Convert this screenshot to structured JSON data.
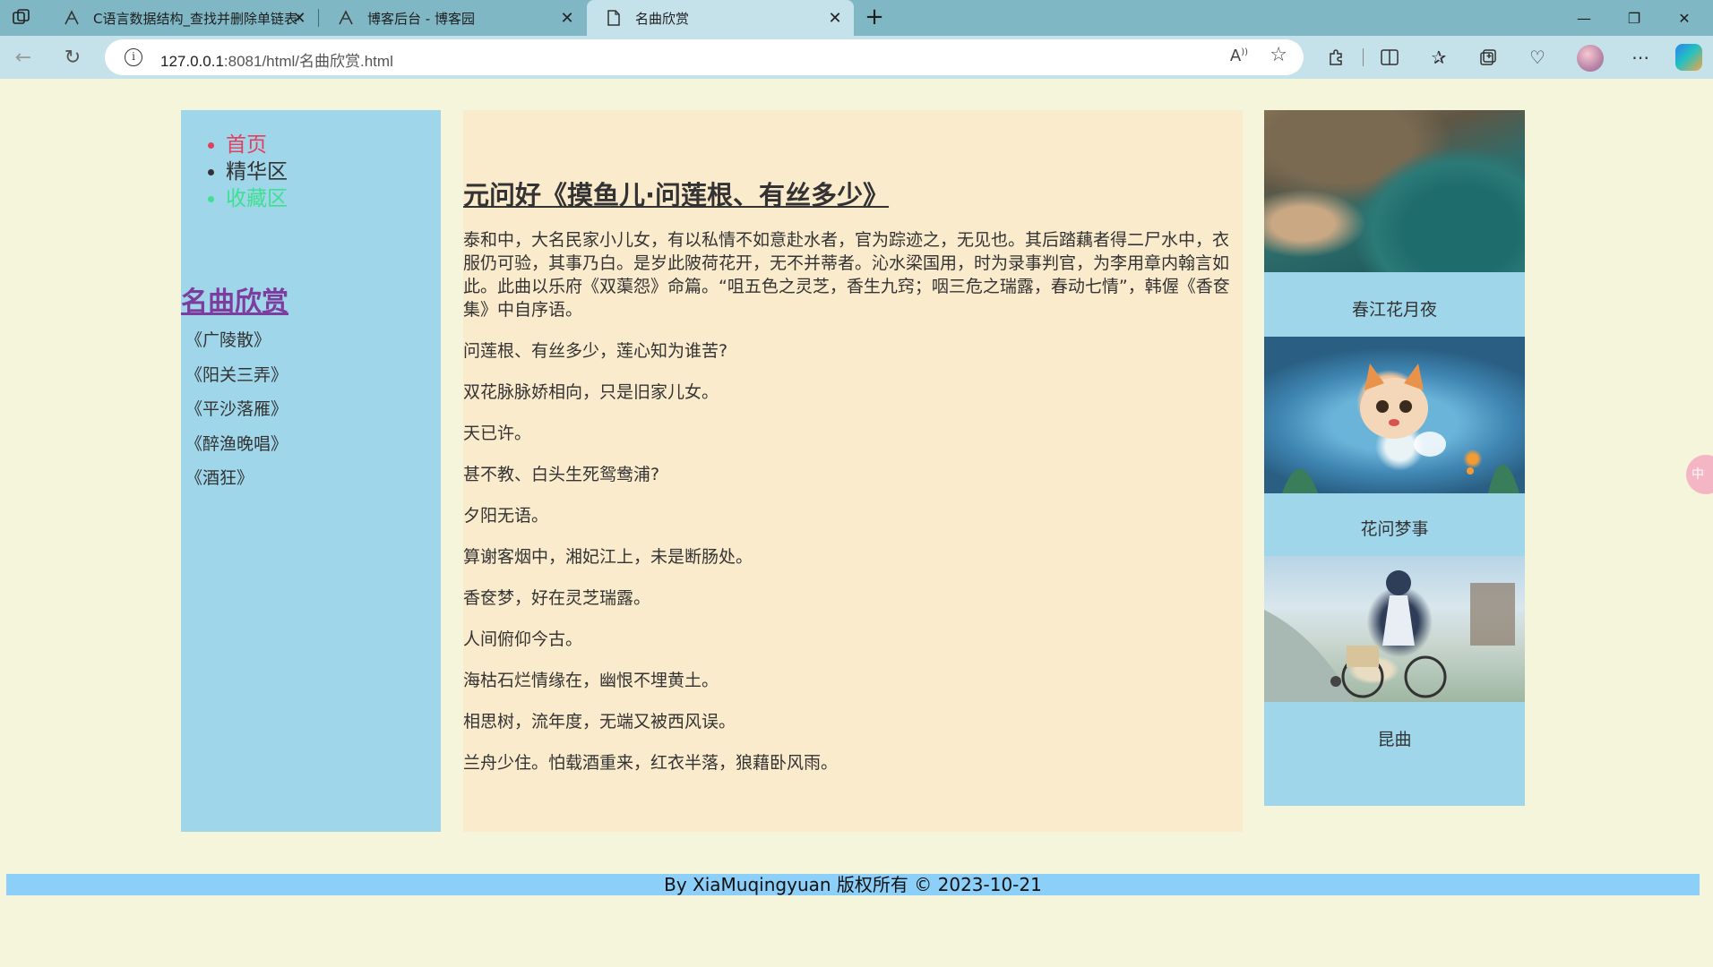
{
  "browser": {
    "tabs": [
      {
        "title": "C语言数据结构_查找并删除单链表中",
        "icon": "blog-logo-icon"
      },
      {
        "title": "博客后台 - 博客园",
        "icon": "blog-logo-icon"
      },
      {
        "title": "名曲欣赏",
        "icon": "page-icon",
        "active": true
      }
    ],
    "new_tab_label": "+",
    "url_host": "127.0.0.1",
    "url_rest": ":8081/html/名曲欣赏.html",
    "window_controls": [
      "minimize",
      "restore",
      "close"
    ]
  },
  "nav": {
    "items": [
      "首页",
      "精华区",
      "收藏区"
    ]
  },
  "sidebar": {
    "title": "名曲欣赏",
    "links": [
      "《广陵散》",
      "《阳关三弄》",
      "《平沙落雁》",
      "《醉渔晚唱》",
      "《酒狂》"
    ]
  },
  "article": {
    "title": "元问好《摸鱼儿·问莲根、有丝多少》",
    "intro": "泰和中，大名民家小儿女，有以私情不如意赴水者，官为踪迹之，无见也。其后踏藕者得二尸水中，衣服仍可验，其事乃白。是岁此陂荷花开，无不并蒂者。沁水梁国用，时为录事判官，为李用章内翰言如此。此曲以乐府《双蕖怨》命篇。“咀五色之灵芝，香生九窍；咽三危之瑞露，春动七情”，韩偓《香奁集》中自序语。",
    "lines": [
      "问莲根、有丝多少，莲心知为谁苦?",
      "双花脉脉娇相向，只是旧家儿女。",
      "天已许。",
      "甚不教、白头生死鸳鸯浦?",
      "夕阳无语。",
      "算谢客烟中，湘妃江上，未是断肠处。",
      "香奁梦，好在灵芝瑞露。",
      "人间俯仰今古。",
      "海枯石烂情缘在，幽恨不埋黄土。",
      "相思树，流年度，无端又被西风误。",
      "兰舟少住。怕载酒重来，红衣半落，狼藉卧风雨。"
    ]
  },
  "gallery": {
    "captions": [
      "春江花月夜",
      "花问梦事",
      "昆曲"
    ]
  },
  "footer": {
    "text": "By XiaMuqingyuan 版权所有 © 2023-10-21"
  },
  "colors": {
    "page_bg": "#f5f5dc",
    "sidebar_bg": "#9fd6ea",
    "main_bg": "#fbebcd",
    "footer_bg": "#8ccff8",
    "nav_home": "#e2405c",
    "nav_favorites": "#3fe08f",
    "sidebar_title": "#7d3d9f"
  }
}
